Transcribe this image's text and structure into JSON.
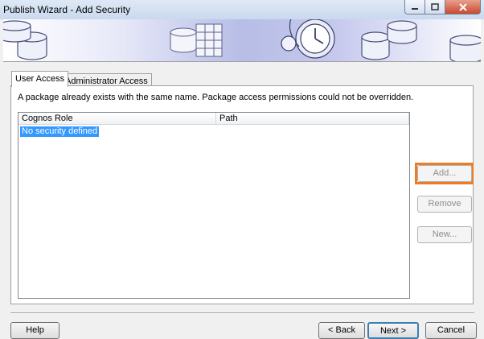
{
  "window": {
    "title": "Publish Wizard - Add Security"
  },
  "tabs": [
    {
      "label": "User Access",
      "active": true
    },
    {
      "label": "Administrator Access",
      "active": false
    }
  ],
  "message": "A package already exists with the same name. Package access permissions could not be overridden.",
  "list": {
    "columns": [
      "Cognos Role",
      "Path"
    ],
    "rows": [
      {
        "role": "No security defined",
        "path": "",
        "selected": true
      }
    ]
  },
  "side_buttons": {
    "add": "Add...",
    "remove": "Remove",
    "new": "New..."
  },
  "footer": {
    "help": "Help",
    "back": "< Back",
    "next": "Next >",
    "cancel": "Cancel"
  },
  "colors": {
    "highlight": "#ef7c22",
    "selection": "#3399ff"
  }
}
